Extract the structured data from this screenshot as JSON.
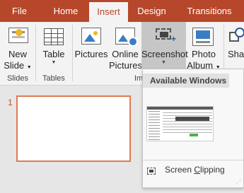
{
  "tabs": [
    {
      "label": "File"
    },
    {
      "label": "Home"
    },
    {
      "label": "Insert"
    },
    {
      "label": "Design"
    },
    {
      "label": "Transitions"
    }
  ],
  "ribbon": {
    "new_slide": {
      "line1": "New",
      "line2": "Slide",
      "icon": "new-slide-icon"
    },
    "table": {
      "label": "Table",
      "icon": "table-icon"
    },
    "pictures": {
      "label": "Pictures",
      "icon": "picture-icon"
    },
    "online_pictures": {
      "line1": "Online",
      "line2": "Pictures",
      "icon": "online-pictures-icon"
    },
    "screenshot": {
      "label": "Screenshot",
      "icon": "screenshot-icon"
    },
    "photo_album": {
      "line1": "Photo",
      "line2": "Album",
      "icon": "photo-album-icon"
    },
    "shapes": {
      "label": "Shap",
      "icon": "shapes-icon"
    },
    "groups": {
      "slides": "Slides",
      "tables": "Tables",
      "images": "Im"
    }
  },
  "slides": [
    {
      "number": "1"
    }
  ],
  "screenshot_menu": {
    "header": "Available Windows",
    "screen_clipping_pre": "Screen ",
    "screen_clipping_key": "C",
    "screen_clipping_post": "lipping"
  },
  "colors": {
    "accent": "#b7472a",
    "ribbon_bg": "#f3f3f3",
    "slide_border": "#e07b53"
  }
}
